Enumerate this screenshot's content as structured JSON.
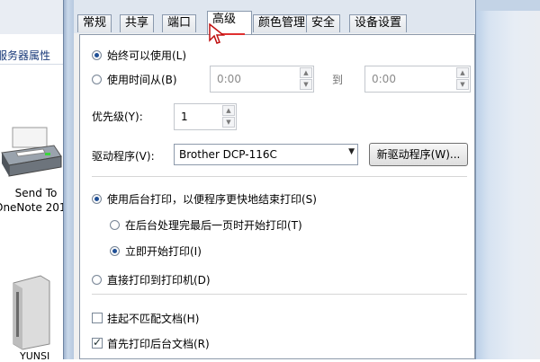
{
  "background": {
    "header_label": "服务器属性",
    "printer_label_line1": "Send To",
    "printer_label_line2": "OneNote 201",
    "drive_label": "YUNSI"
  },
  "tabs": [
    {
      "label": "常规",
      "active": false
    },
    {
      "label": "共享",
      "active": false
    },
    {
      "label": "端口",
      "active": false
    },
    {
      "label": "高级",
      "active": true
    },
    {
      "label": "颜色管理",
      "active": false
    },
    {
      "label": "安全",
      "active": false
    },
    {
      "label": "设备设置",
      "active": false
    }
  ],
  "availability": {
    "always_label": "始终可以使用(L)",
    "always_selected": true,
    "from_label": "使用时间从(B)",
    "from_selected": false,
    "from_value": "0:00",
    "to_label": "到",
    "to_value": "0:00"
  },
  "priority": {
    "label": "优先级(Y):",
    "value": "1"
  },
  "driver": {
    "label": "驱动程序(V):",
    "value": "Brother DCP-116C",
    "new_driver_button": "新驱动程序(W)..."
  },
  "spooling": {
    "spool_label": "使用后台打印，以便程序更快地结束打印(S)",
    "spool_selected": true,
    "after_last_page_label": "在后台处理完最后一页时开始打印(T)",
    "after_last_page_selected": false,
    "immediately_label": "立即开始打印(I)",
    "immediately_selected": true,
    "direct_label": "直接打印到打印机(D)",
    "direct_selected": false
  },
  "options": {
    "hold_mismatched_label": "挂起不匹配文档(H)",
    "hold_mismatched_checked": false,
    "print_spooled_first_label": "首先打印后台文档(R)",
    "print_spooled_first_checked": true
  },
  "colors": {
    "accent": "#1f4f95",
    "underline": "#e03030"
  }
}
